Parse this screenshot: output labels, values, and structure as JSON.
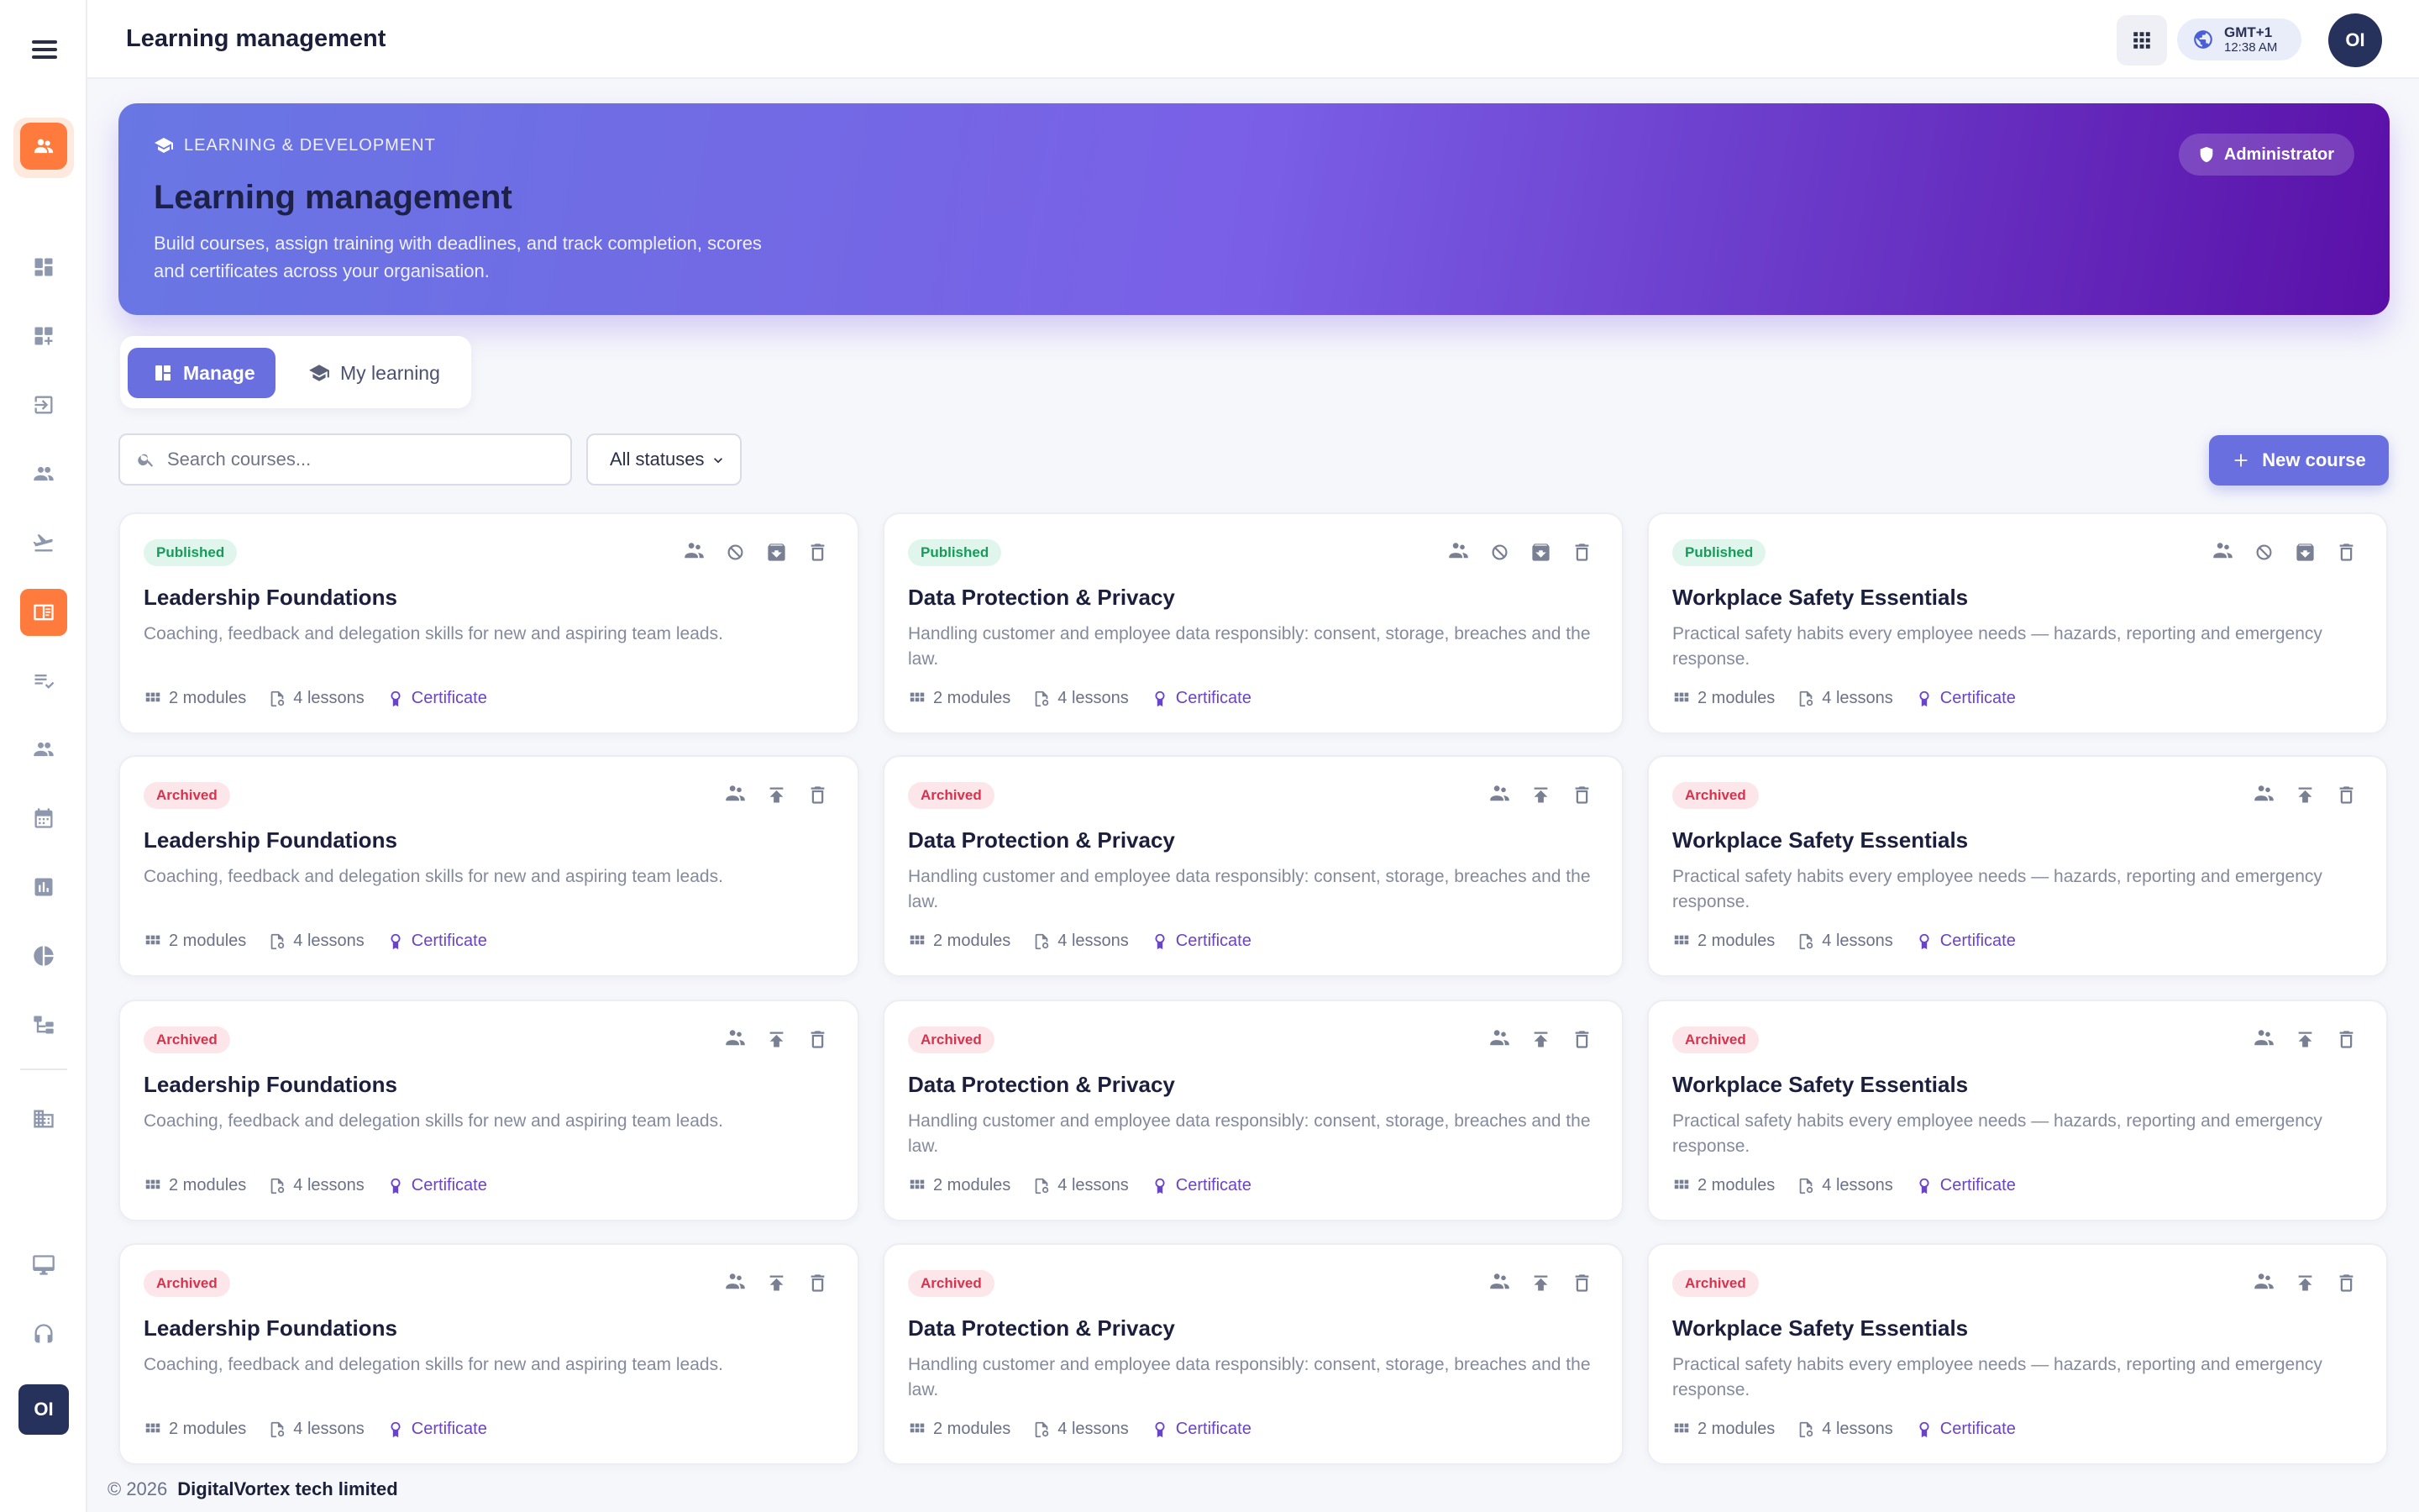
{
  "header": {
    "title": "Learning management",
    "timezone": "GMT+1",
    "time": "12:38 AM",
    "user_initials": "OI"
  },
  "sidebar": {
    "items": [
      {
        "icon": "dashboard-icon"
      },
      {
        "icon": "dashboard-add-icon"
      },
      {
        "icon": "login-icon"
      },
      {
        "icon": "people-icon"
      },
      {
        "icon": "flight-icon"
      },
      {
        "icon": "learning-book-icon",
        "active": true
      },
      {
        "icon": "checklist-icon"
      },
      {
        "icon": "team-icon"
      },
      {
        "icon": "calendar-icon"
      },
      {
        "icon": "bar-chart-icon"
      },
      {
        "icon": "pie-chart-icon"
      },
      {
        "icon": "hierarchy-icon"
      },
      {
        "icon": "building-icon"
      },
      {
        "icon": "desktop-icon"
      },
      {
        "icon": "headset-icon"
      }
    ],
    "user_initials": "OI"
  },
  "hero": {
    "eyebrow": "LEARNING & DEVELOPMENT",
    "title": "Learning management",
    "description": "Build courses, assign training with deadlines, and track completion, scores and certificates across your organisation.",
    "role": "Administrator"
  },
  "tabs": [
    {
      "label": "Manage",
      "active": true
    },
    {
      "label": "My learning",
      "active": false
    }
  ],
  "filters": {
    "search_placeholder": "Search courses...",
    "status_value": "All statuses",
    "new_course_label": "New course"
  },
  "courses": [
    {
      "status": "Published",
      "title": "Leadership Foundations",
      "description": "Coaching, feedback and delegation skills for new and aspiring team leads.",
      "modules": "2 modules",
      "lessons": "4 lessons",
      "certificate": "Certificate"
    },
    {
      "status": "Published",
      "title": "Data Protection & Privacy",
      "description": "Handling customer and employee data responsibly: consent, storage, breaches and the law.",
      "modules": "2 modules",
      "lessons": "4 lessons",
      "certificate": "Certificate"
    },
    {
      "status": "Published",
      "title": "Workplace Safety Essentials",
      "description": "Practical safety habits every employee needs — hazards, reporting and emergency response.",
      "modules": "2 modules",
      "lessons": "4 lessons",
      "certificate": "Certificate"
    },
    {
      "status": "Archived",
      "title": "Leadership Foundations",
      "description": "Coaching, feedback and delegation skills for new and aspiring team leads.",
      "modules": "2 modules",
      "lessons": "4 lessons",
      "certificate": "Certificate"
    },
    {
      "status": "Archived",
      "title": "Data Protection & Privacy",
      "description": "Handling customer and employee data responsibly: consent, storage, breaches and the law.",
      "modules": "2 modules",
      "lessons": "4 lessons",
      "certificate": "Certificate"
    },
    {
      "status": "Archived",
      "title": "Workplace Safety Essentials",
      "description": "Practical safety habits every employee needs — hazards, reporting and emergency response.",
      "modules": "2 modules",
      "lessons": "4 lessons",
      "certificate": "Certificate"
    },
    {
      "status": "Archived",
      "title": "Leadership Foundations",
      "description": "Coaching, feedback and delegation skills for new and aspiring team leads.",
      "modules": "2 modules",
      "lessons": "4 lessons",
      "certificate": "Certificate"
    },
    {
      "status": "Archived",
      "title": "Data Protection & Privacy",
      "description": "Handling customer and employee data responsibly: consent, storage, breaches and the law.",
      "modules": "2 modules",
      "lessons": "4 lessons",
      "certificate": "Certificate"
    },
    {
      "status": "Archived",
      "title": "Workplace Safety Essentials",
      "description": "Practical safety habits every employee needs — hazards, reporting and emergency response.",
      "modules": "2 modules",
      "lessons": "4 lessons",
      "certificate": "Certificate"
    },
    {
      "status": "Archived",
      "title": "Leadership Foundations",
      "description": "Coaching, feedback and delegation skills for new and aspiring team leads.",
      "modules": "2 modules",
      "lessons": "4 lessons",
      "certificate": "Certificate"
    },
    {
      "status": "Archived",
      "title": "Data Protection & Privacy",
      "description": "Handling customer and employee data responsibly: consent, storage, breaches and the law.",
      "modules": "2 modules",
      "lessons": "4 lessons",
      "certificate": "Certificate"
    },
    {
      "status": "Archived",
      "title": "Workplace Safety Essentials",
      "description": "Practical safety habits every employee needs — hazards, reporting and emergency response.",
      "modules": "2 modules",
      "lessons": "4 lessons",
      "certificate": "Certificate"
    }
  ],
  "footer": {
    "copyright": "© 2026",
    "company": "DigitalVortex tech limited"
  },
  "colors": {
    "accent": "#6a6fe0",
    "sidebar_active": "#ff7a3d",
    "published": "#189a5a",
    "archived": "#d8324c",
    "certificate": "#6a43c9"
  }
}
